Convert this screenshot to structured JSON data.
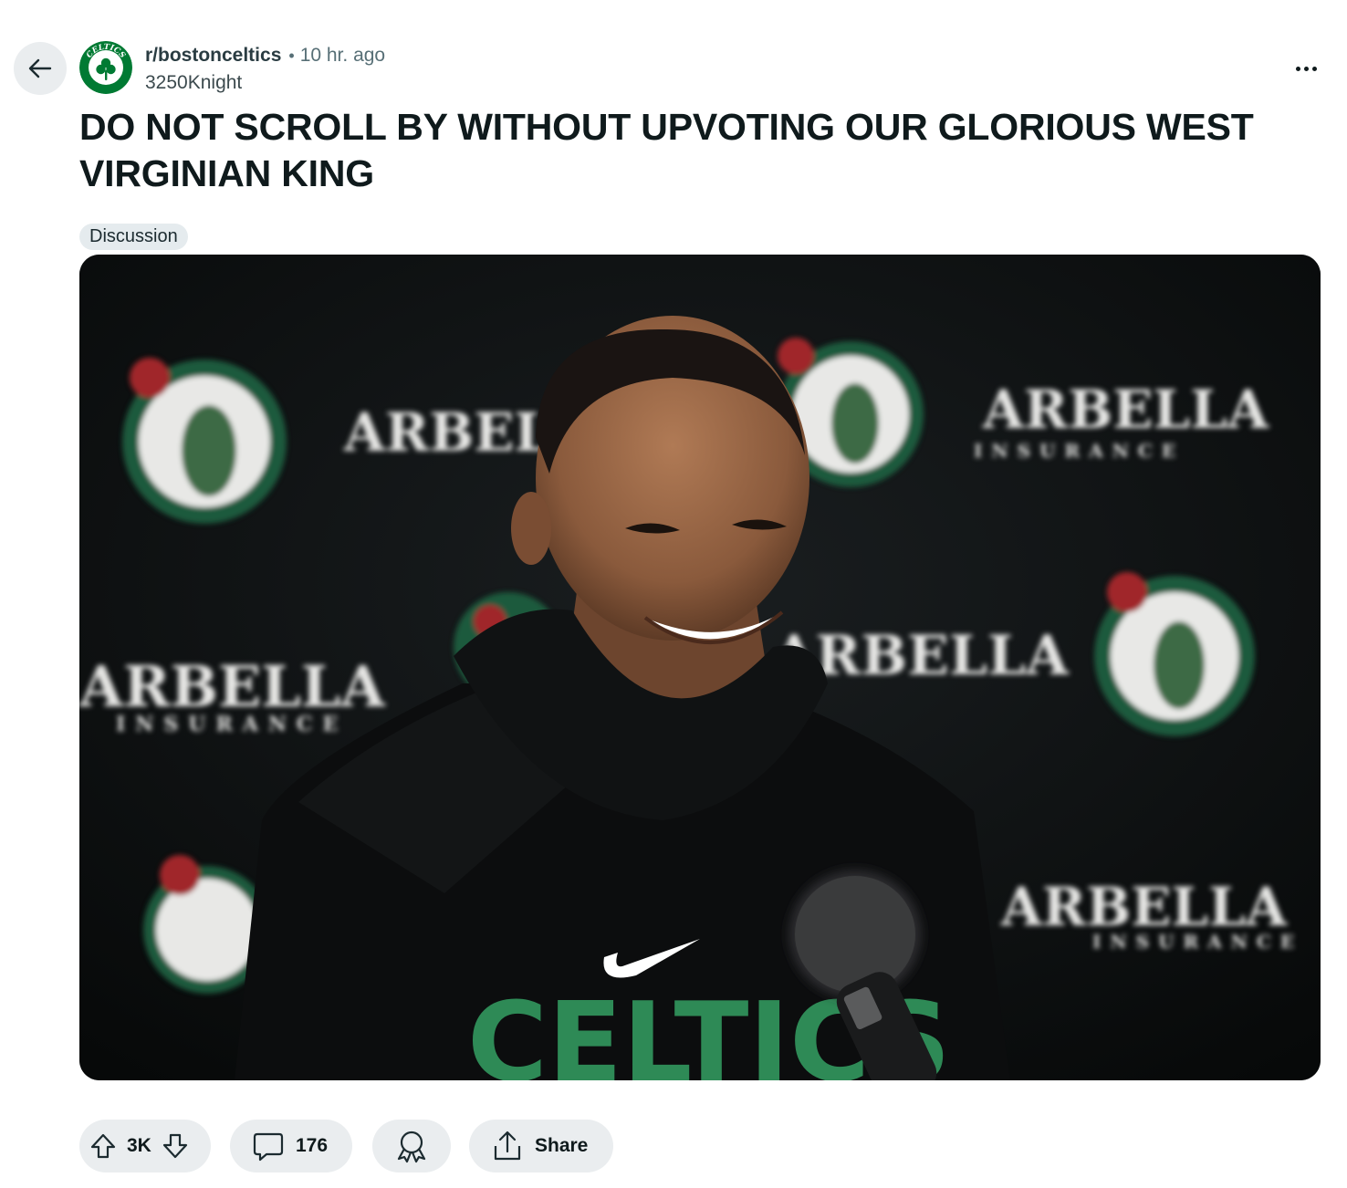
{
  "post": {
    "subreddit": "r/bostonceltics",
    "separator": "•",
    "age": "10 hr. ago",
    "author": "3250Knight",
    "title": "DO NOT SCROLL BY WITHOUT UPVOTING OUR GLORIOUS WEST VIRGINIAN KING",
    "flair": "Discussion",
    "avatar_text": "CELTICS",
    "image_text": {
      "sponsor": "ARBELLA",
      "sponsor_sub": "INSURANCE",
      "shirt": "CELTICS"
    }
  },
  "actions": {
    "score": "3K",
    "comments": "176",
    "share_label": "Share"
  },
  "icons": {
    "back": "arrow-left-icon",
    "more": "more-horizontal-icon",
    "upvote": "upvote-arrow-icon",
    "downvote": "downvote-arrow-icon",
    "comment": "comment-bubble-icon",
    "award": "award-ribbon-icon",
    "share": "share-upload-icon"
  },
  "colors": {
    "celtics_green": "#007a33",
    "pill_bg": "#eaedef",
    "flair_bg": "#e5ebee"
  }
}
